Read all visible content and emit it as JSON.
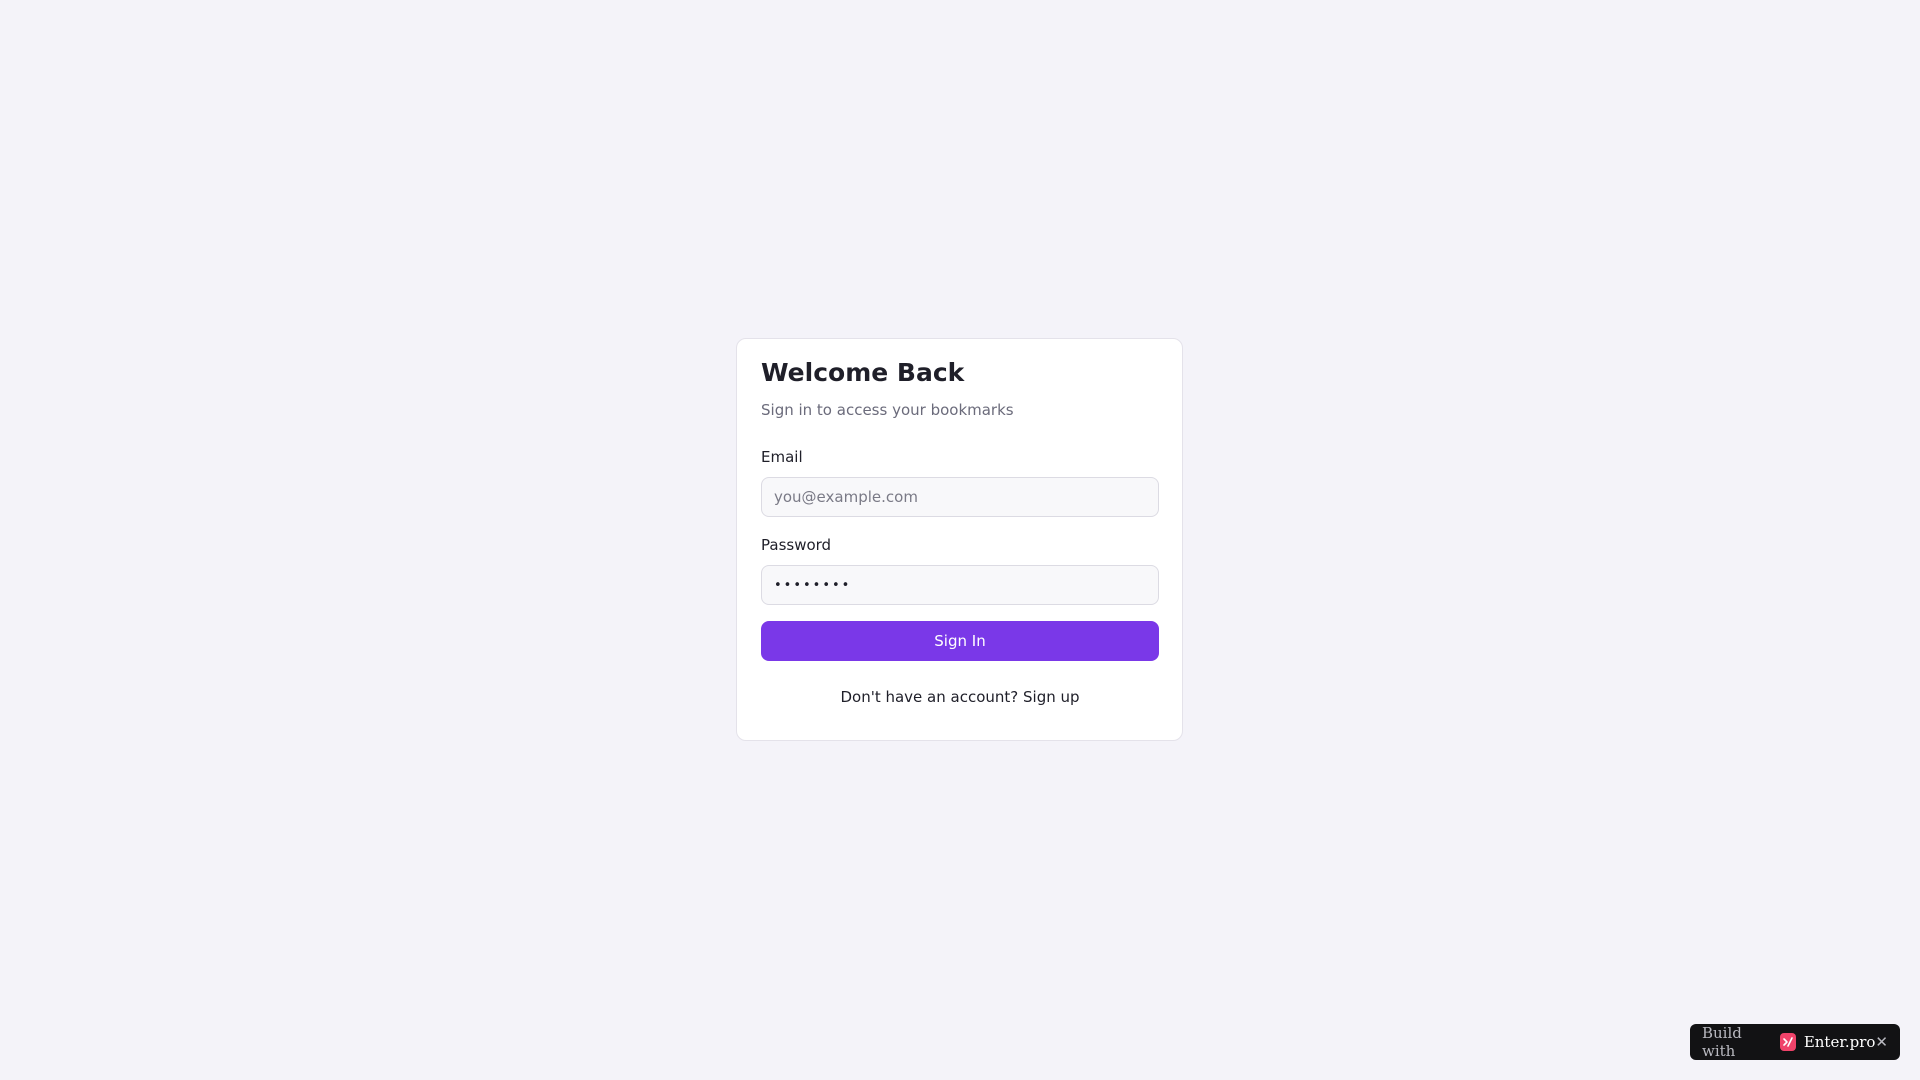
{
  "login": {
    "title": "Welcome Back",
    "subtitle": "Sign in to access your bookmarks",
    "email_label": "Email",
    "email_placeholder": "you@example.com",
    "email_value": "",
    "password_label": "Password",
    "password_value": "••••••••",
    "submit_label": "Sign In",
    "signup_prompt": "Don't have an account? ",
    "signup_link": "Sign up"
  },
  "badge": {
    "prefix": "Build with",
    "brand": "Enter.pro",
    "logo_icon": "enter-pro-logo-icon",
    "close_icon": "close-icon",
    "close_glyph": "✕"
  },
  "colors": {
    "background": "#f4f3f9",
    "accent": "#7a38e8",
    "badge_background": "#121214",
    "logo": "#f0436a"
  }
}
